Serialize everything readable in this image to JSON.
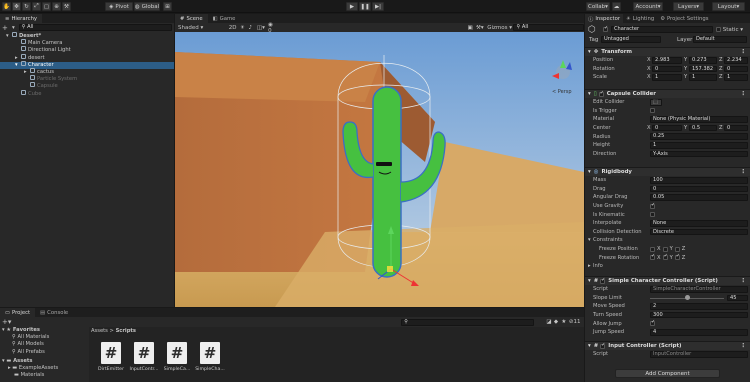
{
  "toolbar": {
    "pivot": "Pivot",
    "global": "Global",
    "collab": "Collab",
    "account": "Account",
    "layers": "Layers",
    "layout": "Layout"
  },
  "hierarchy": {
    "tab": "Hierarchy",
    "create": "+",
    "search": "All",
    "items": [
      {
        "label": "Desert*",
        "depth": 0,
        "selected": false,
        "dim": false
      },
      {
        "label": "Main Camera",
        "depth": 1,
        "selected": false,
        "dim": false
      },
      {
        "label": "Directional Light",
        "depth": 1,
        "selected": false,
        "dim": false
      },
      {
        "label": "desert",
        "depth": 1,
        "selected": false,
        "dim": false
      },
      {
        "label": "Character",
        "depth": 1,
        "selected": true,
        "dim": false
      },
      {
        "label": "cactus",
        "depth": 2,
        "selected": false,
        "dim": false
      },
      {
        "label": "Particle System",
        "depth": 2,
        "selected": false,
        "dim": true
      },
      {
        "label": "Capsule",
        "depth": 2,
        "selected": false,
        "dim": true
      },
      {
        "label": "Cube",
        "depth": 1,
        "selected": false,
        "dim": true
      }
    ]
  },
  "scene": {
    "tab_scene": "Scene",
    "tab_game": "Game",
    "shading": "Shaded",
    "mode": "2D",
    "gizmos": "Gizmos",
    "search": "All",
    "persp": "< Persp"
  },
  "project": {
    "tab_project": "Project",
    "tab_console": "Console",
    "favorites": "Favorites",
    "fav_items": [
      "All Materials",
      "All Models",
      "All Prefabs"
    ],
    "assets": "Assets",
    "asset_items": [
      "ExampleAssets",
      "Materials"
    ],
    "breadcrumb_root": "Assets",
    "breadcrumb_sep": ">",
    "breadcrumb_leaf": "Scripts",
    "count": "11",
    "files": [
      "DirtEmitter",
      "InputContr...",
      "SimpleCa...",
      "SimpleCha..."
    ]
  },
  "inspector": {
    "tab_inspector": "Inspector",
    "tab_lighting": "Lighting",
    "tab_project_settings": "Project Settings",
    "object_name": "Character",
    "static": "Static",
    "tag_label": "Tag",
    "tag_value": "Untagged",
    "layer_label": "Layer",
    "layer_value": "Default",
    "transform": {
      "title": "Transform",
      "position": {
        "label": "Position",
        "x": "2.983",
        "y": "0.273",
        "z": "2.234"
      },
      "rotation": {
        "label": "Rotation",
        "x": "0",
        "y": "157.382",
        "z": "0"
      },
      "scale": {
        "label": "Scale",
        "x": "1",
        "y": "1",
        "z": "1"
      }
    },
    "capsule": {
      "title": "Capsule Collider",
      "edit": "Edit Collider",
      "trigger": "Is Trigger",
      "material_label": "Material",
      "material_value": "None (Physic Material)",
      "center_label": "Center",
      "cx": "0",
      "cy": "0.5",
      "cz": "0",
      "radius_label": "Radius",
      "radius": "0.25",
      "height_label": "Height",
      "height": "1",
      "direction_label": "Direction",
      "direction": "Y-Axis"
    },
    "rigidbody": {
      "title": "Rigidbody",
      "mass_label": "Mass",
      "mass": "100",
      "drag_label": "Drag",
      "drag": "0",
      "angular_label": "Angular Drag",
      "angular": "0.05",
      "gravity_label": "Use Gravity",
      "kinematic_label": "Is Kinematic",
      "interpolate_label": "Interpolate",
      "interpolate": "None",
      "collision_label": "Collision Detection",
      "collision": "Discrete",
      "constraints_label": "Constraints",
      "freeze_pos_label": "Freeze Position",
      "freeze_rot_label": "Freeze Rotation",
      "x": "X",
      "y": "Y",
      "z": "Z",
      "info": "Info"
    },
    "simple_controller": {
      "title": "Simple Character Controller (Script)",
      "script_label": "Script",
      "script_value": "SimpleCharacterController",
      "slope_label": "Slope Limit",
      "slope": "45",
      "slope_fraction": 0.5,
      "move_label": "Move Speed",
      "move": "2",
      "turn_label": "Turn Speed",
      "turn": "300",
      "jump_allow_label": "Allow Jump",
      "jump_speed_label": "Jump Speed",
      "jump_speed": "4"
    },
    "input_controller": {
      "title": "Input Controller (Script)",
      "script_label": "Script",
      "script_value": "InputController"
    },
    "add_component": "Add Component"
  }
}
